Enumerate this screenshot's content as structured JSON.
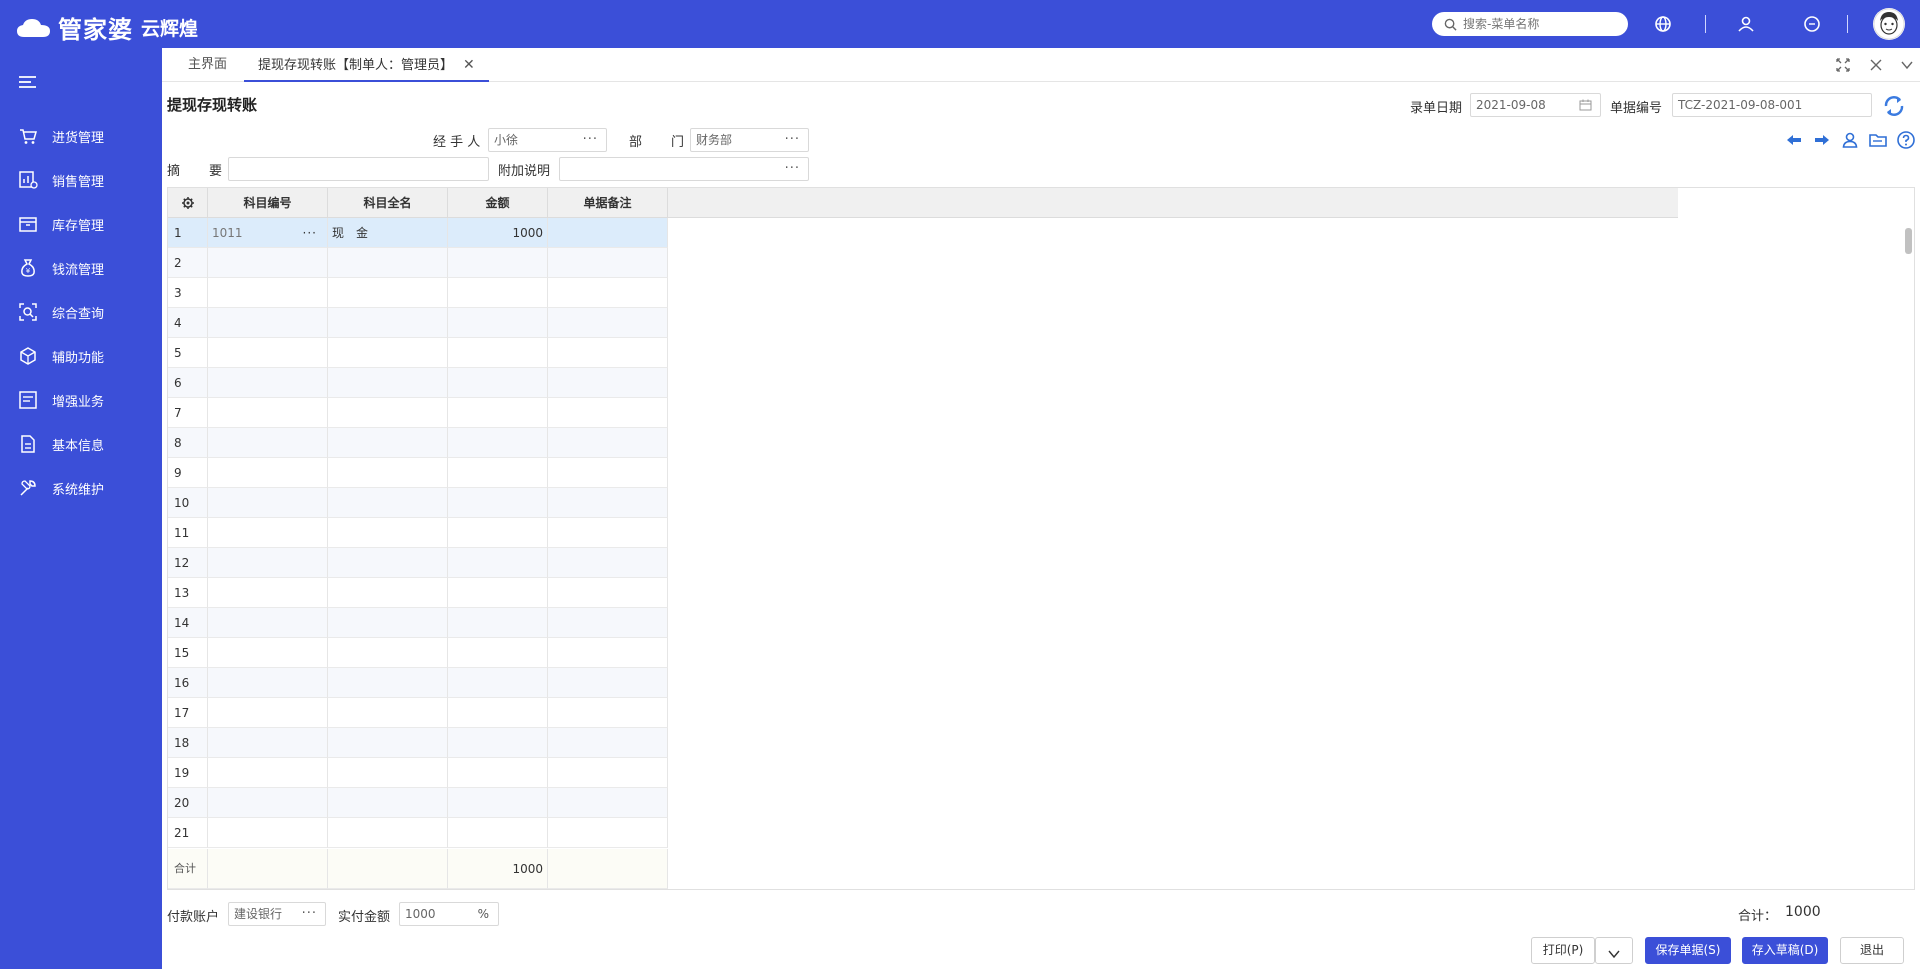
{
  "app": {
    "logo_text": "管家婆",
    "logo_sub": "云辉煌",
    "search_placeholder": "搜索-菜单名称"
  },
  "sidebar": {
    "items": [
      {
        "label": "进货管理",
        "icon": "cart-icon"
      },
      {
        "label": "销售管理",
        "icon": "sales-chart-icon"
      },
      {
        "label": "库存管理",
        "icon": "box-icon"
      },
      {
        "label": "钱流管理",
        "icon": "money-bag-icon"
      },
      {
        "label": "综合查询",
        "icon": "query-icon"
      },
      {
        "label": "辅助功能",
        "icon": "cube-icon"
      },
      {
        "label": "增强业务",
        "icon": "list-icon"
      },
      {
        "label": "基本信息",
        "icon": "document-icon"
      },
      {
        "label": "系统维护",
        "icon": "wrench-icon"
      }
    ]
  },
  "tabs": [
    {
      "label": "主界面"
    },
    {
      "label": "提现存现转账【制单人：管理员】"
    }
  ],
  "form": {
    "title": "提现存现转账",
    "date_label": "录单日期",
    "date_value": "2021-09-08",
    "bill_no_label": "单据编号",
    "bill_no_value": "TCZ-2021-09-08-001",
    "handler_label": "经 手 人",
    "handler_value": "小徐",
    "dept_label_1": "部",
    "dept_label_2": "门",
    "dept_value": "财务部",
    "summary_label_1": "摘",
    "summary_label_2": "要",
    "summary_value": "",
    "extra_label": "附加说明",
    "extra_value": ""
  },
  "grid": {
    "columns": [
      "科目编号",
      "科目全名",
      "金额",
      "单据备注"
    ],
    "rows": [
      {
        "no": "1",
        "code": "1011",
        "name": "现　金",
        "amount": "1000",
        "note": ""
      },
      {
        "no": "2"
      },
      {
        "no": "3"
      },
      {
        "no": "4"
      },
      {
        "no": "5"
      },
      {
        "no": "6"
      },
      {
        "no": "7"
      },
      {
        "no": "8"
      },
      {
        "no": "9"
      },
      {
        "no": "10"
      },
      {
        "no": "11"
      },
      {
        "no": "12"
      },
      {
        "no": "13"
      },
      {
        "no": "14"
      },
      {
        "no": "15"
      },
      {
        "no": "16"
      },
      {
        "no": "17"
      },
      {
        "no": "18"
      },
      {
        "no": "19"
      },
      {
        "no": "20"
      },
      {
        "no": "21"
      }
    ],
    "sum_label": "合计",
    "sum_amount": "1000"
  },
  "footer": {
    "pay_account_label": "付款账户",
    "pay_account_value": "建设银行",
    "paid_amount_label": "实付金额",
    "paid_amount_value": "1000",
    "total_label": "合计：",
    "total_value": "1000",
    "print_label": "打印(P)",
    "save_label": "保存单据(S)",
    "draft_label": "存入草稿(D)",
    "exit_label": "退出"
  },
  "colors": {
    "primary": "#3b4fd8",
    "selected_row": "#dcecfb"
  }
}
